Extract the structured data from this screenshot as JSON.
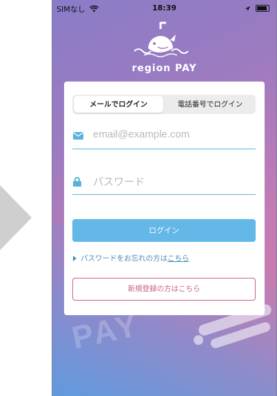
{
  "status_bar": {
    "carrier": "SIMなし",
    "time": "18:39"
  },
  "brand": {
    "name": "region PAY"
  },
  "login_tabs": {
    "email_tab": "メールでログイン",
    "phone_tab": "電話番号でログイン",
    "active": "email_tab"
  },
  "form": {
    "email_placeholder": "email@example.com",
    "password_placeholder": "パスワード",
    "login_button": "ログイン"
  },
  "forgot": {
    "text": "パスワードをお忘れの方は",
    "link": "こちら"
  },
  "register": {
    "label": "新規登録の方はこちら"
  },
  "background": {
    "watermark_text": "PAY"
  },
  "colors": {
    "accent_blue": "#64b8e8",
    "field_line": "#5ab2d9",
    "register_pink": "#c95f8b",
    "link_blue": "#4a8bbd"
  },
  "icons": [
    "wifi-icon",
    "location-arrow-icon",
    "battery-icon",
    "whale-logo-icon",
    "mail-icon",
    "lock-icon",
    "triangle-right-icon"
  ]
}
